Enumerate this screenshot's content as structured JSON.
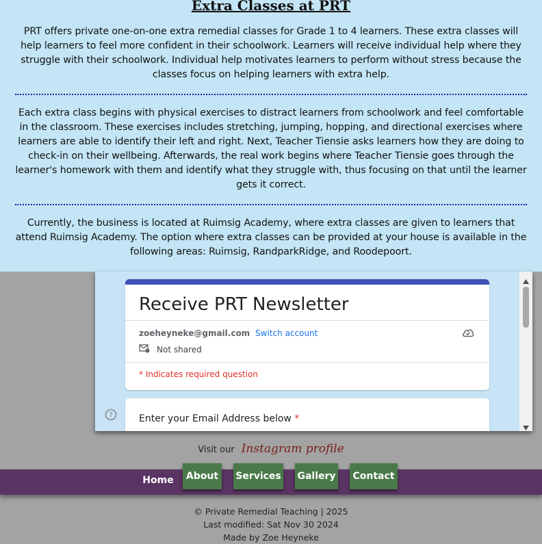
{
  "info": {
    "heading": "Extra Classes at PRT",
    "paragraphs": [
      "PRT offers private one-on-one extra remedial classes for Grade 1 to 4 learners. These extra classes will help learners to feel more confident in their schoolwork. Learners will receive individual help where they struggle with their schoolwork. Individual help motivates learners to perform without stress because the classes focus on helping learners with extra help.",
      "Each extra class begins with physical exercises to distract learners from schoolwork and feel comfortable in the classroom. These exercises includes stretching, jumping, hopping, and directional exercises where learners are able to identify their left and right. Next, Teacher Tiensie asks learners how they are doing to check-in on their wellbeing. Afterwards, the real work begins where Teacher Tiensie goes through the learner's homework with them and identify what they struggle with, thus focusing on that until the learner gets it correct.",
      "Currently, the business is located at Ruimsig Academy, where extra classes are given to learners that attend Ruimsig Academy. The option where extra classes can be provided at your house is available in the following areas: Ruimsig, RandparkRidge, and Roodepoort."
    ]
  },
  "form": {
    "title": "Receive PRT Newsletter",
    "account_email": "zoeheyneke@gmail.com",
    "switch_account": "Switch account",
    "not_shared": "Not shared",
    "required_note": "* Indicates required question",
    "question_label": "Enter your Email Address below",
    "required_star": "*"
  },
  "social": {
    "prefix": "Visit our",
    "link": "Instagram profile"
  },
  "nav": {
    "home": "Home",
    "about": "About",
    "services": "Services",
    "gallery": "Gallery",
    "contact": "Contact"
  },
  "footer": {
    "copyright": "© Private Remedial Teaching | 2025",
    "modified": "Last modified: Sat Nov 30 2024",
    "made_by": "Made by Zoe Heyneke"
  },
  "colors": {
    "info_bg": "#c3e5f5",
    "nav_bg": "#5a3563",
    "nav_button": "#4a7a49",
    "form_accent": "#3f51b5"
  }
}
